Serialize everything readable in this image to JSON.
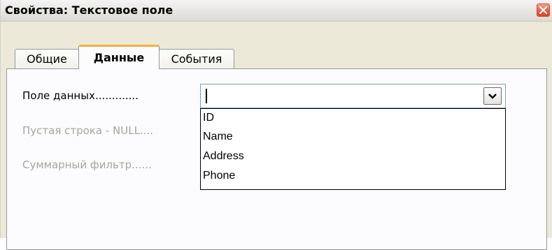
{
  "window": {
    "title": "Свойства: Текстовое поле",
    "close_icon": "close-icon"
  },
  "tabs": [
    {
      "label": "Общие",
      "active": false
    },
    {
      "label": "Данные",
      "active": true
    },
    {
      "label": "События",
      "active": false
    }
  ],
  "fields": {
    "data_field_label": "Поле данных.............",
    "empty_string_label": "Пустая строка - NULL....",
    "filter_label": "Суммарный фильтр......"
  },
  "combo": {
    "value": "",
    "dropdown_icon": "chevron-down-icon",
    "options": [
      "ID",
      "Name",
      "Address",
      "Phone"
    ]
  },
  "colors": {
    "active_tab_accent": "#f7b23d",
    "close_button": "#e6593c",
    "disabled_text": "#a7a59c"
  }
}
